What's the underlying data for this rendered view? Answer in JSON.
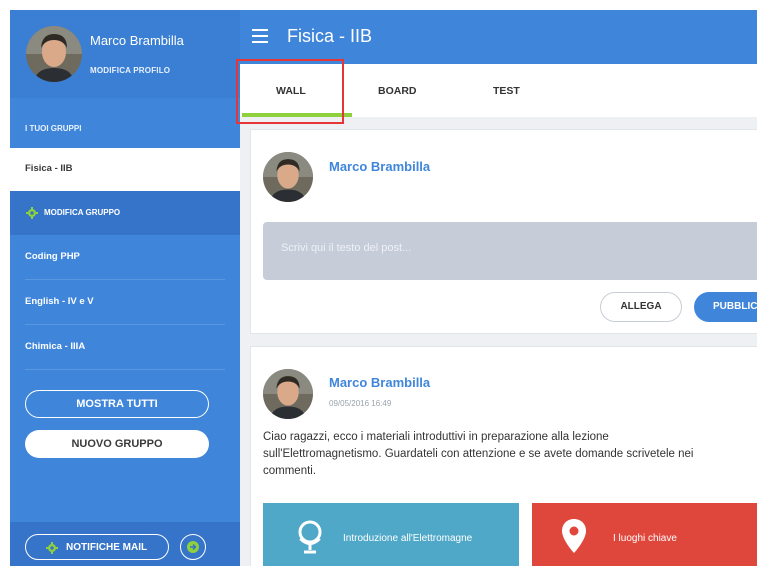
{
  "colors": {
    "primary": "#3f86db",
    "primary_dark": "#3574c9",
    "accent_green": "#8ed13c",
    "highlight_red": "#e53535",
    "attachment_blue": "#4fa8c8",
    "attachment_red": "#e0473c"
  },
  "sidebar": {
    "profile": {
      "name": "Marco Brambilla",
      "edit_link": "MODIFICA PROFILO"
    },
    "groups_label": "I TUOI GRUPPI",
    "active_group": "Fisica - IIB",
    "edit_group": "MODIFICA GRUPPO",
    "groups": [
      "Coding PHP",
      "English - IV e V",
      "Chimica - IIIA"
    ],
    "show_all": "MOSTRA TUTTI",
    "new_group": "NUOVO GRUPPO",
    "mail_notifications": "NOTIFICHE MAIL",
    "icons": {
      "edit_group": "gear-icon",
      "notifications": "gear-icon",
      "logout": "logout-icon"
    }
  },
  "header": {
    "title": "Fisica - IIB",
    "menu_icon": "hamburger-icon"
  },
  "tabs": [
    {
      "label": "WALL",
      "active": true
    },
    {
      "label": "BOARD",
      "active": false
    },
    {
      "label": "TEST",
      "active": false
    }
  ],
  "composer": {
    "author": "Marco Brambilla",
    "placeholder": "Scrivi qui il testo del post...",
    "attach_label": "ALLEGA",
    "publish_label": "PUBBLICA"
  },
  "post": {
    "author": "Marco Brambilla",
    "timestamp": "09/05/2016 16:49",
    "text": "Ciao ragazzi, ecco i materiali introduttivi in preparazione alla lezione\nsull'Elettromagnetismo. Guardateli con attenzione e se avete domande scrivetele nei\ncommenti.",
    "attachments": [
      {
        "label": "Introduzione all'Elettromagne",
        "icon": "globe-icon"
      },
      {
        "label": "I luoghi chiave",
        "icon": "map-pin-icon"
      }
    ]
  }
}
